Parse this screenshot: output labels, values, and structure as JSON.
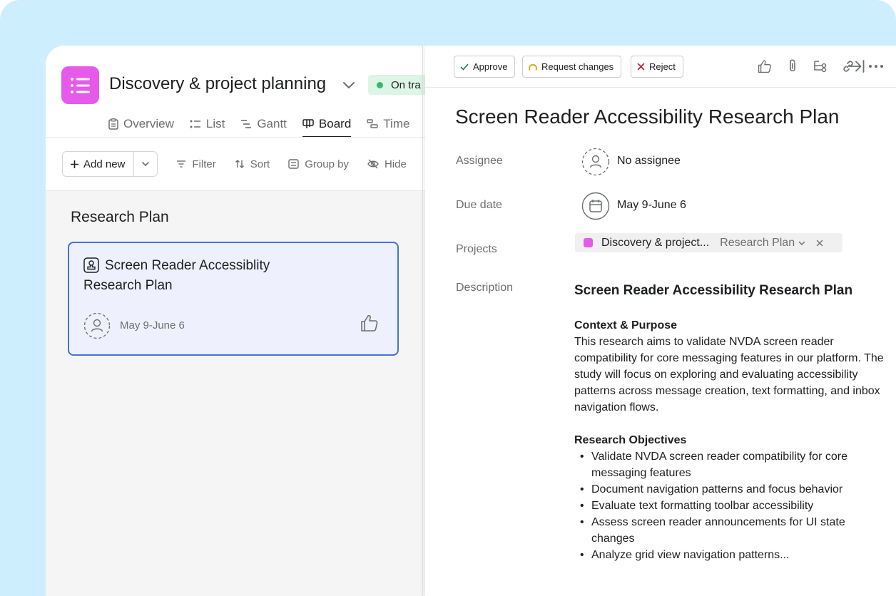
{
  "project": {
    "title": "Discovery & project planning",
    "status": "On tra"
  },
  "tabs": [
    {
      "label": "Overview",
      "icon": "clipboard-icon"
    },
    {
      "label": "List",
      "icon": "list-icon"
    },
    {
      "label": "Gantt",
      "icon": "gantt-icon"
    },
    {
      "label": "Board",
      "icon": "board-icon",
      "active": true
    },
    {
      "label": "Time",
      "icon": "timeline-icon"
    }
  ],
  "toolbar": {
    "add_new": "Add new",
    "filter": "Filter",
    "sort": "Sort",
    "group_by": "Group by",
    "hide": "Hide"
  },
  "board": {
    "column_title": "Research Plan",
    "card": {
      "title": "Screen Reader Accessiblity Research Plan",
      "date": "May 9-June 6"
    }
  },
  "detail": {
    "actions": {
      "approve": "Approve",
      "request_changes": "Request changes",
      "reject": "Reject"
    },
    "title": "Screen Reader Accessibility Research Plan",
    "labels": {
      "assignee": "Assignee",
      "due_date": "Due date",
      "projects": "Projects",
      "description": "Description"
    },
    "assignee": "No assignee",
    "due_date": "May 9-June 6",
    "project_chip": {
      "name": "Discovery & project...",
      "section": "Research Plan"
    },
    "description": {
      "title": "Screen Reader Accessibility Research Plan",
      "context_heading": "Context & Purpose",
      "context_text": "This research aims to validate NVDA screen reader compatibility for core messaging features in our platform. The study will focus on exploring and evaluating accessibility patterns across message creation, text formatting, and inbox navigation flows.",
      "objectives_heading": "Research Objectives",
      "objectives": [
        "Validate NVDA screen reader compatibility for core messaging features",
        "Document navigation patterns and focus behavior",
        "Evaluate text formatting toolbar accessibility",
        "Assess screen reader announcements for UI state changes",
        "Analyze grid view navigation patterns..."
      ]
    }
  },
  "colors": {
    "background": "#cdeefc",
    "project_icon": "#e55ae9",
    "status_pill": "#dcf5e6",
    "status_dot": "#35b870",
    "card_border": "#4573d2",
    "card_fill": "#eef0fd",
    "approve_check": "#1e7a44",
    "request_changes": "#f1a20a",
    "reject_x": "#c8183a"
  }
}
